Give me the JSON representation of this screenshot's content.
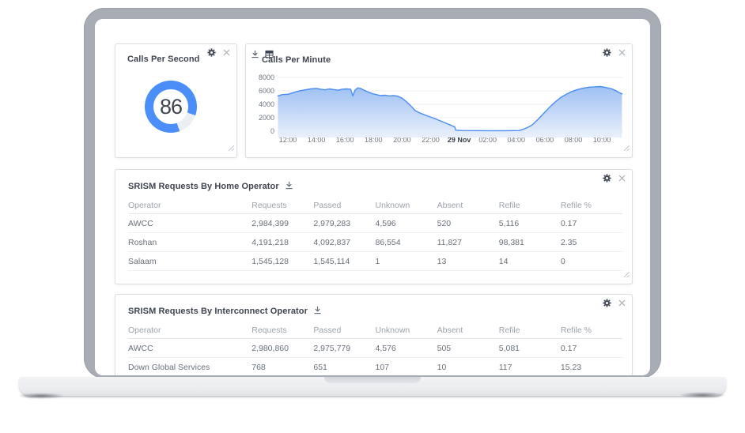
{
  "colors": {
    "accent": "#4C8EF7",
    "gauge_track": "#ECEFF1",
    "chart_line": "#4A8DF2",
    "area_top": "#9DC0F3",
    "area_bottom": "#E9F0FB",
    "grid_line": "#ECEEF1",
    "axis_line": "#D5D8DC"
  },
  "widget_cps": {
    "title": "Calls Per Second",
    "value": "86"
  },
  "widget_cpm": {
    "title": "Calls Per Minute"
  },
  "tables": {
    "home": {
      "title": "SRISM Requests By Home Operator",
      "headers": [
        "Operator",
        "Requests",
        "Passed",
        "Unknown",
        "Absent",
        "Refile",
        "Refile %"
      ],
      "rows": [
        [
          "AWCC",
          "2,984,399",
          "2,979,283",
          "4,596",
          "520",
          "5,116",
          "0.17"
        ],
        [
          "Roshan",
          "4,191,218",
          "4,092,837",
          "86,554",
          "11,827",
          "98,381",
          "2.35"
        ],
        [
          "Salaam",
          "1,545,128",
          "1,545,114",
          "1",
          "13",
          "14",
          "0"
        ]
      ]
    },
    "interconnect": {
      "title": "SRISM Requests By Interconnect Operator",
      "headers": [
        "Operator",
        "Requests",
        "Passed",
        "Unknown",
        "Absent",
        "Refile",
        "Refile %"
      ],
      "rows": [
        [
          "AWCC",
          "2,980,860",
          "2,975,779",
          "4,576",
          "505",
          "5,081",
          "0.17"
        ],
        [
          "Down Global Services",
          "768",
          "651",
          "107",
          "10",
          "117",
          "15.23"
        ]
      ]
    }
  },
  "chart_data": [
    {
      "type": "gauge",
      "title": "Calls Per Second",
      "value": 86,
      "max": 100
    },
    {
      "type": "area",
      "title": "Calls Per Minute",
      "ylim": [
        0,
        8000
      ],
      "yticks": [
        8000,
        6000,
        4000,
        2000,
        0
      ],
      "xticklabels": [
        "12:00",
        "14:00",
        "16:00",
        "18:00",
        "20:00",
        "22:00",
        "29 Nov",
        "02:00",
        "04:00",
        "06:00",
        "08:00",
        "10:00"
      ],
      "x_hours": [
        -0.7,
        -0.4,
        0,
        0.4,
        0.8,
        1.2,
        1.6,
        2,
        2.3,
        2.6,
        2.9,
        3.2,
        3.5,
        3.8,
        4.1,
        4.4,
        4.55,
        4.7,
        4.9,
        5.1,
        5.35,
        5.6,
        5.9,
        6.2,
        6.5,
        6.8,
        7.1,
        7.4,
        7.7,
        8,
        8.3,
        8.6,
        8.9,
        9.2,
        9.5,
        9.8,
        10.2,
        10.6,
        11,
        11.4,
        11.7,
        11.75,
        12.2,
        13,
        14,
        15,
        15.8,
        16.2,
        16.5,
        16.8,
        17.1,
        17.5,
        17.9,
        18.3,
        18.7,
        19.1,
        19.5,
        19.9,
        20.3,
        20.7,
        21.1,
        21.5,
        21.9,
        22.3,
        22.7,
        23,
        23.2,
        23.4
      ],
      "values": [
        5250,
        5450,
        5500,
        5750,
        6000,
        6150,
        6300,
        6350,
        6250,
        6150,
        6300,
        6200,
        6100,
        6250,
        6300,
        6250,
        5250,
        6100,
        6450,
        6350,
        6100,
        5850,
        5600,
        5450,
        5300,
        5350,
        5250,
        5300,
        5200,
        4900,
        4400,
        3800,
        3100,
        2750,
        2500,
        2250,
        1950,
        1600,
        1250,
        900,
        600,
        150,
        100,
        80,
        70,
        70,
        80,
        100,
        300,
        550,
        900,
        1700,
        2600,
        3500,
        4300,
        5000,
        5500,
        5900,
        6200,
        6400,
        6550,
        6600,
        6650,
        6500,
        6300,
        6000,
        5750,
        5550
      ]
    }
  ]
}
